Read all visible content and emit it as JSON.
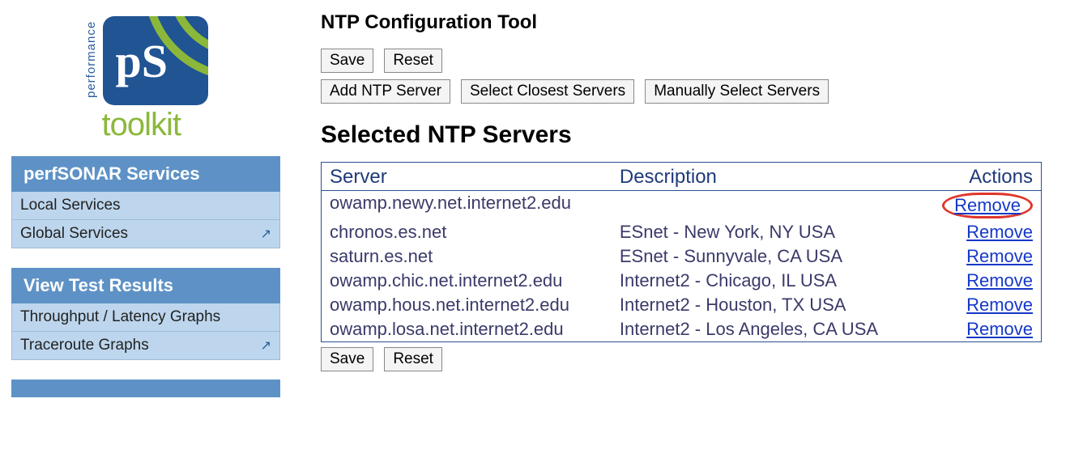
{
  "logo": {
    "performance_label": "performance",
    "ps_text": "pS",
    "toolkit_text": "toolkit"
  },
  "sidebar": {
    "sections": [
      {
        "header": "perfSONAR Services",
        "items": [
          {
            "label": "Local Services",
            "external": false
          },
          {
            "label": "Global Services",
            "external": true
          }
        ]
      },
      {
        "header": "View Test Results",
        "items": [
          {
            "label": "Throughput / Latency Graphs",
            "external": false
          },
          {
            "label": "Traceroute Graphs",
            "external": true
          }
        ]
      }
    ]
  },
  "main": {
    "title": "NTP Configuration Tool",
    "buttons_top": {
      "save": "Save",
      "reset": "Reset",
      "add_ntp": "Add NTP Server",
      "select_closest": "Select Closest Servers",
      "manual_select": "Manually Select Servers"
    },
    "selected_heading": "Selected NTP Servers",
    "table": {
      "columns": {
        "server": "Server",
        "description": "Description",
        "actions": "Actions"
      },
      "remove_label": "Remove",
      "rows": [
        {
          "server": "owamp.newy.net.internet2.edu",
          "description": "",
          "highlight": true
        },
        {
          "server": "chronos.es.net",
          "description": "ESnet - New York, NY USA",
          "highlight": false
        },
        {
          "server": "saturn.es.net",
          "description": "ESnet - Sunnyvale, CA USA",
          "highlight": false
        },
        {
          "server": "owamp.chic.net.internet2.edu",
          "description": "Internet2 - Chicago, IL USA",
          "highlight": false
        },
        {
          "server": "owamp.hous.net.internet2.edu",
          "description": "Internet2 - Houston, TX USA",
          "highlight": false
        },
        {
          "server": "owamp.losa.net.internet2.edu",
          "description": "Internet2 - Los Angeles, CA USA",
          "highlight": false
        }
      ]
    },
    "buttons_bottom": {
      "save": "Save",
      "reset": "Reset"
    }
  }
}
